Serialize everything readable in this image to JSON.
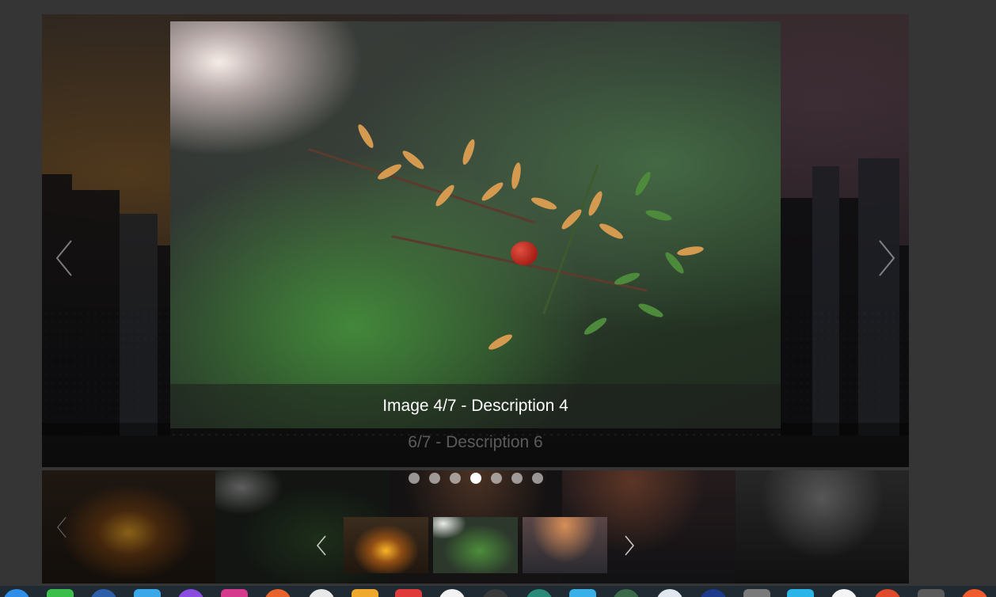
{
  "main_slider": {
    "behind_caption": "6/7 - Description 6",
    "photo_caption": "Image 4/7 - Description 4",
    "prev_icon": "chevron-left-icon",
    "next_icon": "chevron-right-icon"
  },
  "thumbnail_strip": {
    "dot_count": 7,
    "active_dot_index": 3,
    "thumbnails": [
      "arch-corridor",
      "plant-berry",
      "city-skyline"
    ],
    "prev_icon": "chevron-left-icon",
    "next_icon": "chevron-right-icon"
  },
  "dock": {
    "icons": [
      {
        "name": "finder-icon",
        "color": "#2f8fe8"
      },
      {
        "name": "trash-icon",
        "color": "#3bbf4a"
      },
      {
        "name": "app-icon-blue",
        "color": "#2c5fa8"
      },
      {
        "name": "folder-icon",
        "color": "#3aa8e8"
      },
      {
        "name": "app-icon-purple",
        "color": "#8a4de0"
      },
      {
        "name": "app-icon-magenta",
        "color": "#d63a8c"
      },
      {
        "name": "app-icon-orange",
        "color": "#e8642c"
      },
      {
        "name": "app-icon-white",
        "color": "#e8e8e8"
      },
      {
        "name": "app-icon-yellow",
        "color": "#f0a82c"
      },
      {
        "name": "app-icon-red",
        "color": "#e03a3a"
      },
      {
        "name": "app-icon-white2",
        "color": "#f2f2f2"
      },
      {
        "name": "app-icon-dark",
        "color": "#3a3a3a"
      },
      {
        "name": "app-icon-teal",
        "color": "#2a8a7a"
      },
      {
        "name": "app-icon-cyan",
        "color": "#3ab0e8"
      },
      {
        "name": "app-icon-green",
        "color": "#3a6a4a"
      },
      {
        "name": "app-icon-white3",
        "color": "#e0e6ee"
      },
      {
        "name": "app-icon-navy",
        "color": "#1e3a8a"
      },
      {
        "name": "app-icon-grey",
        "color": "#7a7a7a"
      },
      {
        "name": "app-icon-sky",
        "color": "#2ab4e8"
      },
      {
        "name": "app-icon-white4",
        "color": "#f4f4f4"
      },
      {
        "name": "app-icon-red2",
        "color": "#e04a2c"
      },
      {
        "name": "app-icon-grey2",
        "color": "#5a5a5a"
      },
      {
        "name": "app-icon-orange2",
        "color": "#f05a2c"
      }
    ]
  }
}
